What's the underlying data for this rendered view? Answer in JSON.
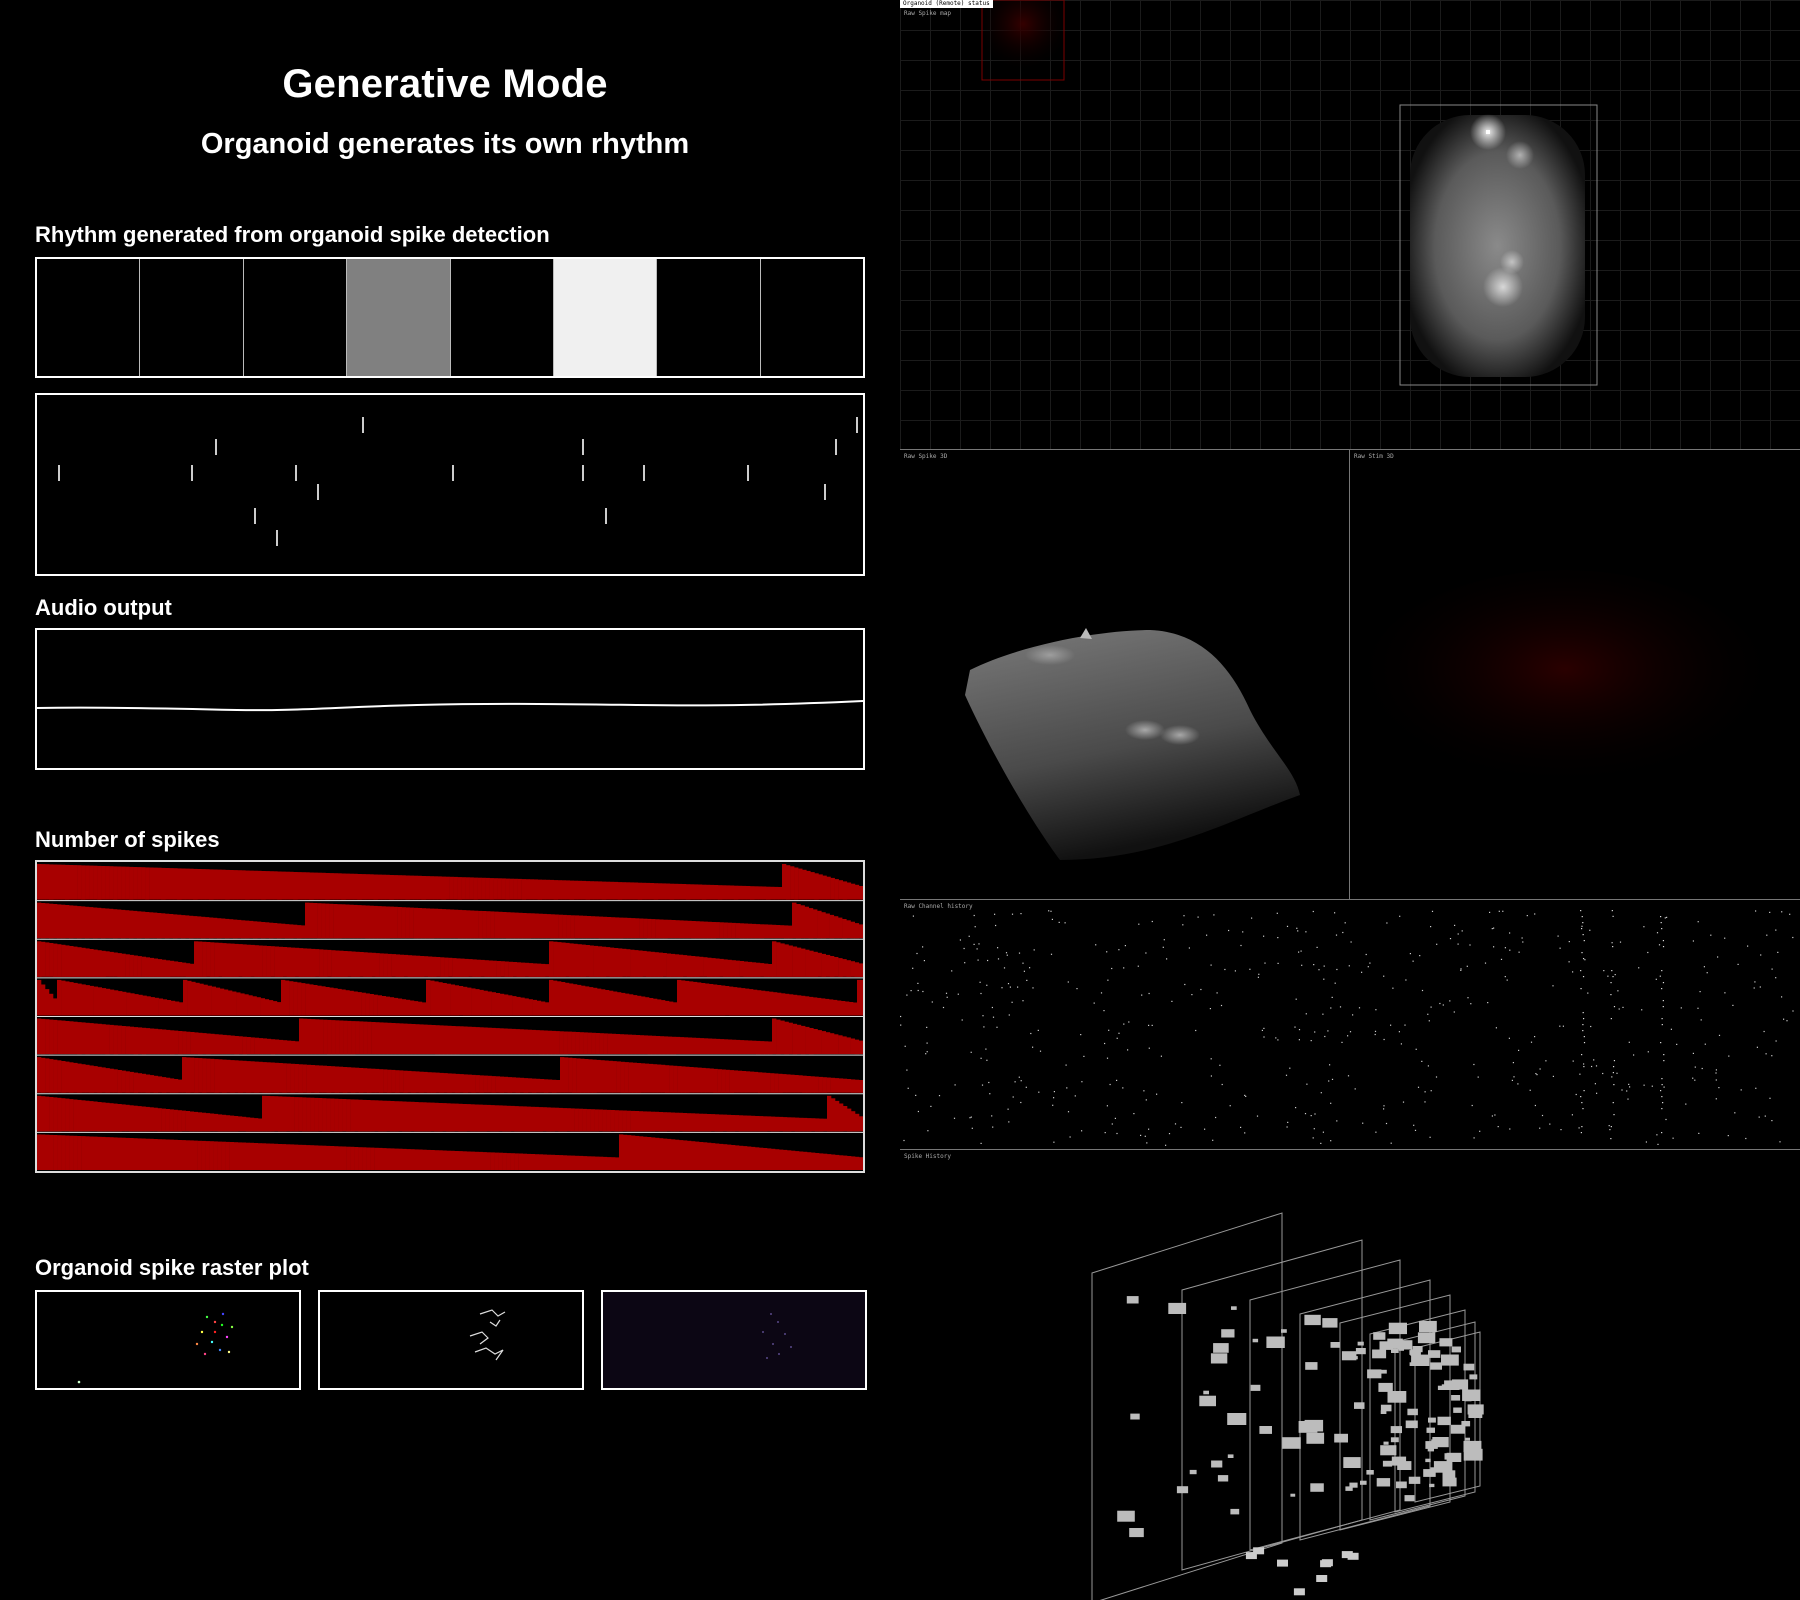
{
  "header": {
    "title": "Generative Mode",
    "subtitle": "Organoid generates its own rhythm"
  },
  "sections": {
    "rhythm": "Rhythm generated from organoid spike detection",
    "audio": "Audio output",
    "spike_count": "Number of spikes",
    "raster": "Organoid spike raster plot"
  },
  "rhythm_steps": [
    0,
    0,
    0,
    0.5,
    0,
    0.94,
    0,
    0
  ],
  "colors": {
    "background": "#000000",
    "text": "#ffffff",
    "spike_bar": "#a80000",
    "divider": "#777777"
  },
  "right_panel": {
    "status_badge": "Organoid (Remote) status",
    "panes": {
      "spike_map": "Raw Spike map",
      "spike_3d": "Raw Spike 3D",
      "stim_3d": "Raw Stim 3D",
      "channel_history": "Raw Channel history",
      "spike_history": "Spike History"
    }
  },
  "icons": {
    "raster_1": "colored-dot-cluster",
    "raster_2": "white-trace-cluster",
    "raster_3": "purple-grid-noise"
  }
}
